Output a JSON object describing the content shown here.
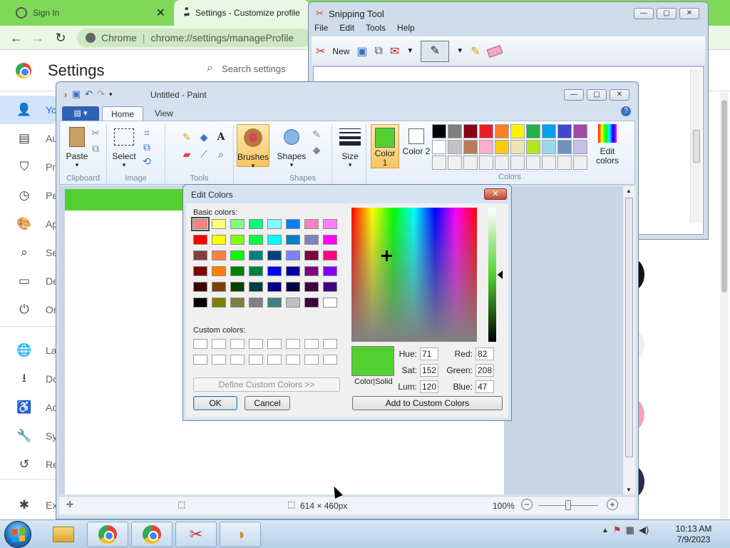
{
  "chrome": {
    "tabs": [
      {
        "label": "Sign In"
      },
      {
        "label": "Settings - Customize profile"
      }
    ],
    "omnibox": {
      "site": "Chrome",
      "url": "chrome://settings/manageProfile"
    },
    "settings_title": "Settings",
    "search_placeholder": "Search settings",
    "sidebar": [
      "Yo",
      "Au",
      "Pr",
      "Pe",
      "Ap",
      "Se",
      "De",
      "On",
      "La",
      "Do",
      "Ac",
      "Sy",
      "Re",
      "Ex"
    ]
  },
  "snipping": {
    "title": "Snipping Tool",
    "menu": [
      "File",
      "Edit",
      "Tools",
      "Help"
    ],
    "new_label": "New"
  },
  "paint": {
    "title": "Untitled - Paint",
    "tabs": [
      "Home",
      "View"
    ],
    "groups": {
      "clipboard": "Clipboard",
      "image": "Image",
      "tools": "Tools",
      "shapes": "Shapes",
      "colors": "Colors"
    },
    "buttons": {
      "paste": "Paste",
      "select": "Select",
      "brushes": "Brushes",
      "shapes": "Shapes",
      "size": "Size",
      "color1": "Color 1",
      "color2": "Color 2",
      "edit_colors": "Edit colors"
    },
    "palette": [
      "#000000",
      "#7f7f7f",
      "#880015",
      "#ed1c24",
      "#ff7f27",
      "#fff200",
      "#22b14c",
      "#00a2e8",
      "#3f48cc",
      "#a349a4",
      "#ffffff",
      "#c3c3c3",
      "#b97a57",
      "#ffaec9",
      "#ffc90e",
      "#efe4b0",
      "#b5e61d",
      "#99d9ea",
      "#7092be",
      "#c8bfe7",
      "#f0f0f0",
      "#f0f0f0",
      "#f0f0f0",
      "#f0f0f0",
      "#f0f0f0",
      "#f0f0f0",
      "#f0f0f0",
      "#f0f0f0",
      "#f0f0f0",
      "#f0f0f0"
    ],
    "color1": "#52d02f",
    "color2": "#ffffff",
    "status": {
      "size": "614 × 460px",
      "zoom": "100%"
    }
  },
  "dialog": {
    "title": "Edit Colors",
    "basic_label": "Basic colors:",
    "basic_colors": [
      "#ff8080",
      "#ffff80",
      "#80ff80",
      "#00ff80",
      "#80ffff",
      "#0080ff",
      "#ff80c0",
      "#ff80ff",
      "#ff0000",
      "#ffff00",
      "#80ff00",
      "#00ff40",
      "#00ffff",
      "#0080c0",
      "#8080c0",
      "#ff00ff",
      "#804040",
      "#ff8040",
      "#00ff00",
      "#008080",
      "#004080",
      "#8080ff",
      "#800040",
      "#ff0080",
      "#800000",
      "#ff8000",
      "#008000",
      "#008040",
      "#0000ff",
      "#0000a0",
      "#800080",
      "#8000ff",
      "#400000",
      "#804000",
      "#004000",
      "#004040",
      "#000080",
      "#000040",
      "#400040",
      "#400080",
      "#000000",
      "#808000",
      "#808040",
      "#808080",
      "#408080",
      "#c0c0c0",
      "#400040",
      "#ffffff"
    ],
    "custom_label": "Custom colors:",
    "define_btn": "Define Custom Colors >>",
    "ok": "OK",
    "cancel": "Cancel",
    "preview_label": "Color|Solid",
    "fields": {
      "hue_label": "Hue:",
      "hue": "71",
      "sat_label": "Sat:",
      "sat": "152",
      "lum_label": "Lum:",
      "lum": "120",
      "red_label": "Red:",
      "red": "82",
      "green_label": "Green:",
      "green": "208",
      "blue_label": "Blue:",
      "blue": "47"
    },
    "add_custom": "Add to Custom Colors",
    "current_color": "#52d02f"
  },
  "taskbar": {
    "time": "10:13 AM",
    "date": "7/9/2023"
  }
}
